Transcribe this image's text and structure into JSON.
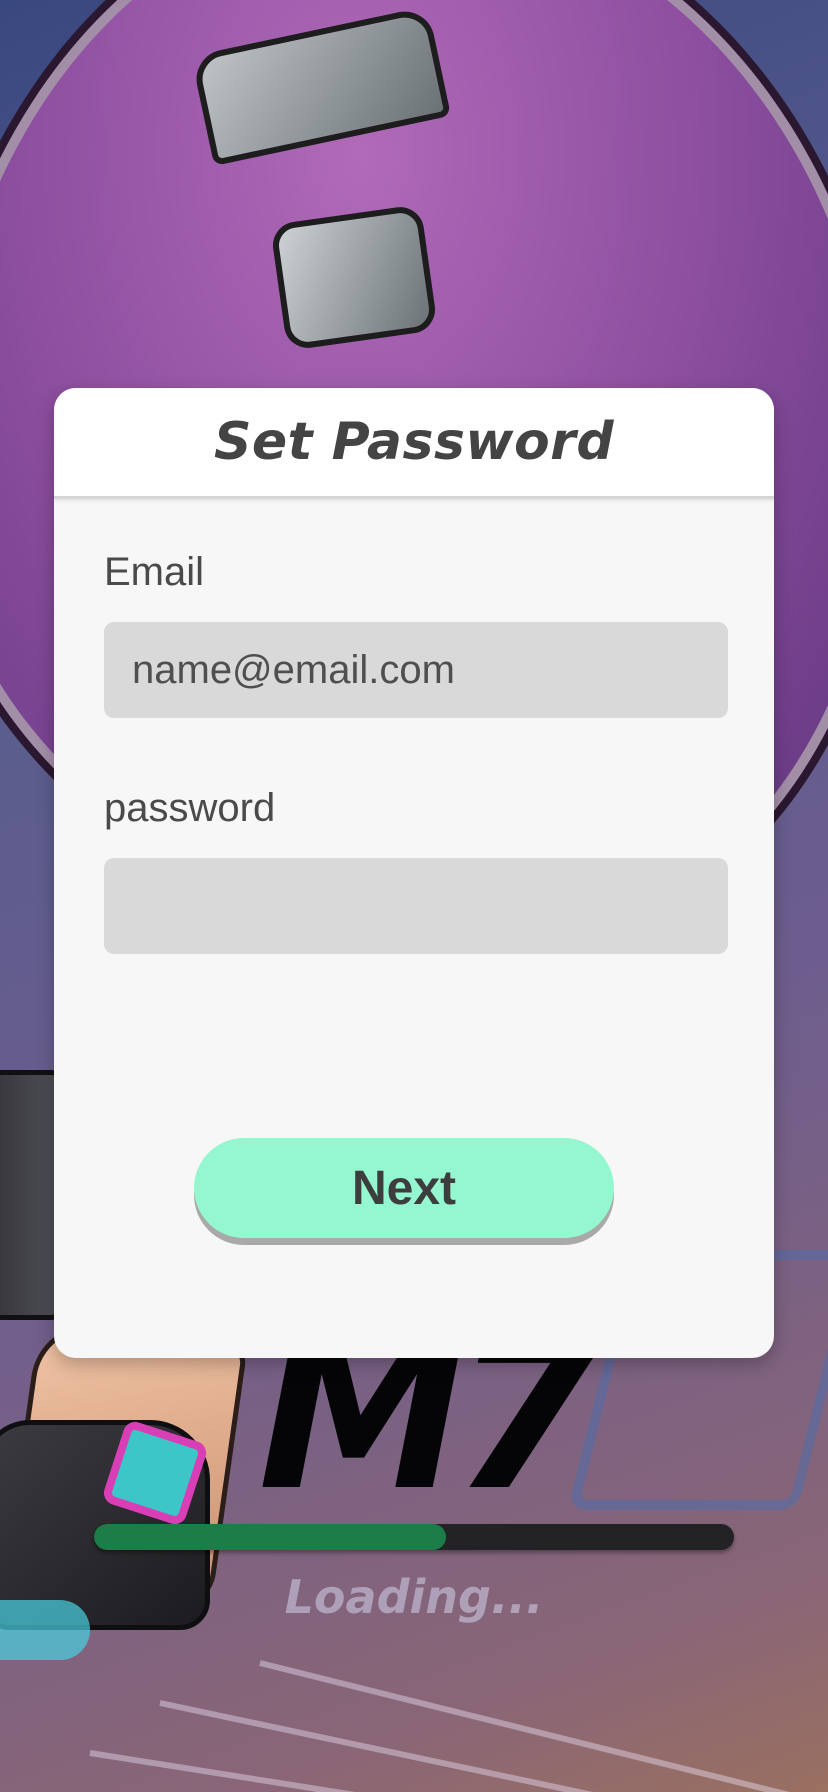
{
  "dialog": {
    "title": "Set Password",
    "email_label": "Email",
    "email_placeholder": "name@email.com",
    "email_value": "",
    "password_label": "password",
    "password_value": "",
    "next_label": "Next"
  },
  "loading": {
    "text": "Loading...",
    "progress": 0.55
  },
  "logo": {
    "text": "M7"
  },
  "colors": {
    "accent_button": "#94f7cf",
    "progress_fill": "#1c7d48",
    "progress_track": "#232326",
    "input_bg": "#d9d9d9"
  }
}
